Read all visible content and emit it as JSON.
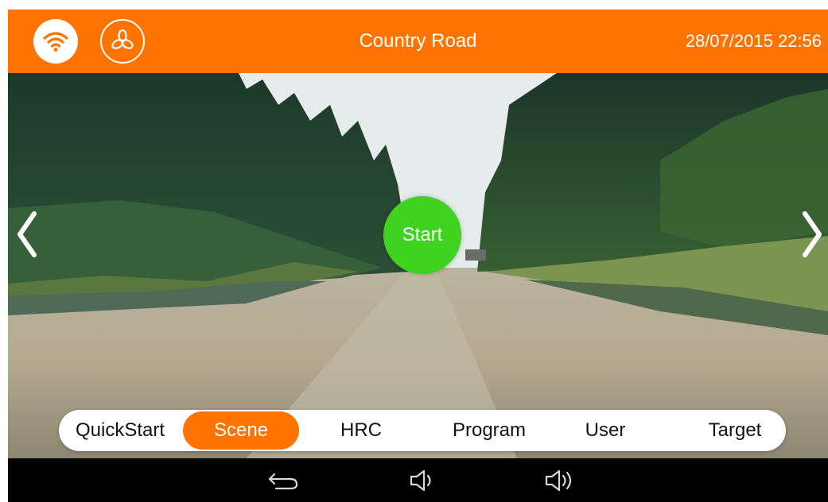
{
  "header": {
    "title": "Country Road",
    "datetime": "28/07/2015 22:56",
    "icons": [
      "wifi-icon",
      "fan-icon"
    ],
    "bar_color": "#ff7300"
  },
  "scene": {
    "start_label": "Start",
    "start_color": "#3fd220",
    "prev_icon": "chevron-left-icon",
    "next_icon": "chevron-right-icon"
  },
  "tabs": [
    {
      "label": "QuickStart",
      "active": false
    },
    {
      "label": "Scene",
      "active": true
    },
    {
      "label": "HRC",
      "active": false
    },
    {
      "label": "Program",
      "active": false
    },
    {
      "label": "User",
      "active": false
    },
    {
      "label": "Target",
      "active": false
    }
  ],
  "system_bar": {
    "icons": [
      "back-icon",
      "volume-down-icon",
      "volume-up-icon"
    ]
  }
}
